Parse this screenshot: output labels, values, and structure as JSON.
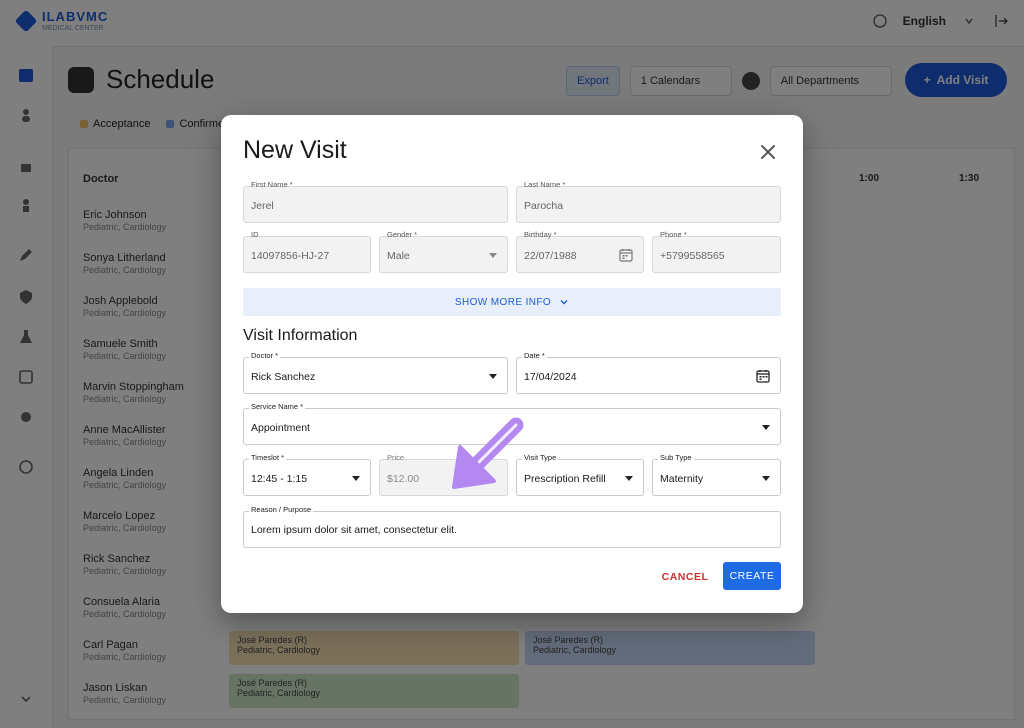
{
  "app": {
    "logo_title": "ILABVMC",
    "logo_subtitle": "MEDICAL CENTER",
    "language": "English",
    "page_title": "Schedule",
    "view_chip": "Export",
    "date_chip": "1 Calendars",
    "department_chip": "All Departments",
    "add_button": "Add Visit",
    "legend": [
      "Acceptance",
      "Confirmed"
    ],
    "grid_header": "Doctor",
    "time_cols": [
      "1:00",
      "1:30"
    ],
    "doctors": [
      {
        "name": "Eric Johnson",
        "role": "Pediatric, Cardiology"
      },
      {
        "name": "Sonya Litherland",
        "role": "Pediatric, Cardiology"
      },
      {
        "name": "Josh Applebold",
        "role": "Pediatric, Cardiology"
      },
      {
        "name": "Samuele Smith",
        "role": "Pediatric, Cardiology"
      },
      {
        "name": "Marvin Stoppingham",
        "role": "Pediatric, Cardiology"
      },
      {
        "name": "Anne MacAllister",
        "role": "Pediatric, Cardiology"
      },
      {
        "name": "Angela Linden",
        "role": "Pediatric, Cardiology"
      },
      {
        "name": "Marcelo Lopez",
        "role": "Pediatric, Cardiology"
      },
      {
        "name": "Rick Sanchez",
        "role": "Pediatric, Cardiology"
      },
      {
        "name": "Consuela Alaria",
        "role": "Pediatric, Cardiology"
      },
      {
        "name": "Carl Pagan",
        "role": "Pediatric, Cardiology"
      },
      {
        "name": "Jason Liskan",
        "role": "Pediatric, Cardiology"
      }
    ],
    "blocks": [
      {
        "title": "José Paredes (R)",
        "sub": "Pediatric, Cardiology"
      },
      {
        "title": "José Paredes (R)",
        "sub": "Pediatric, Cardiology"
      },
      {
        "title": "José Paredes (R)",
        "sub": "Pediatric, Cardiology"
      }
    ]
  },
  "modal": {
    "title": "New Visit",
    "patient": {
      "first_name": {
        "label": "First Name *",
        "value": "Jerel"
      },
      "last_name": {
        "label": "Last Name *",
        "value": "Parocha"
      },
      "id": {
        "label": "ID",
        "value": "14097856-HJ-27"
      },
      "gender": {
        "label": "Gender *",
        "value": "Male"
      },
      "birthday": {
        "label": "Birthday *",
        "value": "22/07/1988"
      },
      "phone": {
        "label": "Phone *",
        "value": "+5799558565"
      }
    },
    "show_more": "SHOW MORE INFO",
    "section_title": "Visit Information",
    "visit": {
      "doctor": {
        "label": "Doctor *",
        "value": "Rick Sanchez"
      },
      "date": {
        "label": "Date *",
        "value": "17/04/2024"
      },
      "service": {
        "label": "Service Name *",
        "value": "Appointment"
      },
      "timeslot": {
        "label": "Timeslot *",
        "value": "12:45 - 1:15"
      },
      "price": {
        "label": "Price",
        "value": "$12.00"
      },
      "visit_type": {
        "label": "Visit Type",
        "value": "Prescription Refill"
      },
      "sub_type": {
        "label": "Sub Type",
        "value": "Maternity"
      },
      "reason": {
        "label": "Reason / Purpose",
        "value": "Lorem ipsum dolor sit amet, consectetur elit."
      }
    },
    "cancel": "CANCEL",
    "create": "CREATE"
  },
  "colors": {
    "primary": "#1e6be3",
    "cancel": "#d32f2f",
    "show_more_bg": "#e8eefa",
    "annotation_arrow": "#b388f0"
  }
}
